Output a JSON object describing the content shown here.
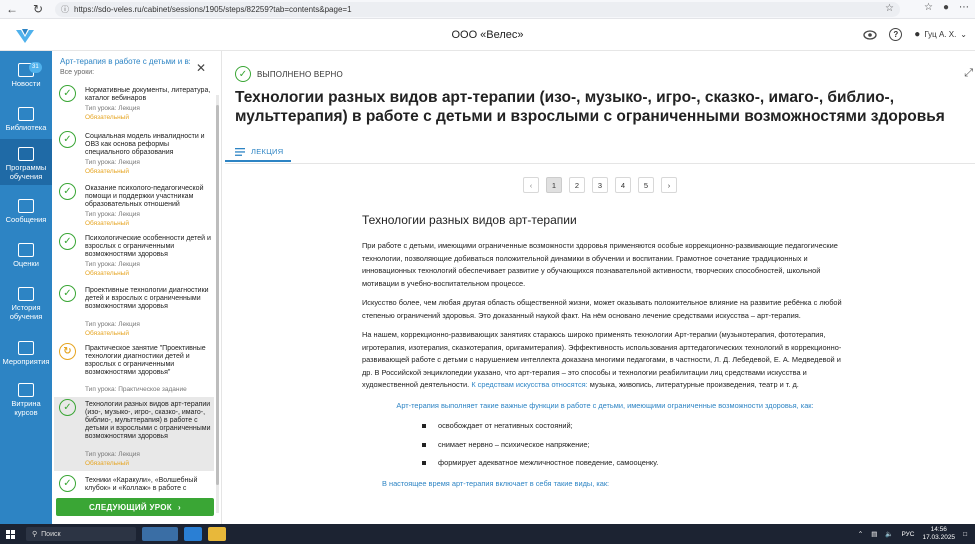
{
  "browser": {
    "url": "https://sdo-veles.ru/cabinet/sessions/1905/steps/82259?tab=contents&page=1"
  },
  "header": {
    "org": "ООО «Велес»",
    "user": "Гуц А. Х."
  },
  "leftnav": [
    {
      "label": "Новости",
      "badge": "31"
    },
    {
      "label": "Библиотека"
    },
    {
      "label": "Программы обучения"
    },
    {
      "label": "Сообщения"
    },
    {
      "label": "Оценки"
    },
    {
      "label": "История обучения"
    },
    {
      "label": "Мероприятия"
    },
    {
      "label": "Витрина курсов"
    }
  ],
  "lessons_panel": {
    "course_title": "Арт-терапия в работе с детьми и взр...",
    "subtitle": "Все уроки:",
    "items": [
      {
        "title": "Нормативные документы, литература, каталог вебинаров",
        "type": "Тип урока: Лекция",
        "required": "Обязательный",
        "status": "done"
      },
      {
        "title": "Социальная модель инвалидности и ОВЗ как основа реформы специального образования",
        "type": "Тип урока: Лекция",
        "required": "Обязательный",
        "status": "done"
      },
      {
        "title": "Оказание психолого-педагогической помощи и поддержки участникам образовательных отношений",
        "type": "Тип урока: Лекция",
        "required": "Обязательный",
        "status": "done"
      },
      {
        "title": "Психологические особенности детей и взрослых с ограниченными возможностями здоровья",
        "type": "Тип урока: Лекция",
        "required": "Обязательный",
        "status": "done"
      },
      {
        "title": "Проективные технологии диагностики детей и взрослых с ограниченными возможностями здоровья",
        "type": "Тип урока: Лекция",
        "required": "Обязательный",
        "status": "done"
      },
      {
        "title": "Практическое занятие \"Проективные технологии диагностики детей и взрослых с ограниченными возможностями здоровья\"",
        "type": "Тип урока: Практическое задание",
        "required": "",
        "status": "pending"
      },
      {
        "title": "Технологии разных видов арт-терапии (изо-, музыко-, игро-, сказко-, имаго-, библио-, мульттерапия) в работе с детьми и взрослыми с ограниченными возможностями здоровья",
        "type": "Тип урока: Лекция",
        "required": "Обязательный",
        "status": "done"
      },
      {
        "title": "Техники «Каракули», «Волшебный клубок» и «Коллаж» в работе с",
        "type": "",
        "required": "",
        "status": "done"
      }
    ],
    "next_button": "СЛЕДУЮЩИЙ УРОК"
  },
  "main": {
    "status": "ВЫПОЛНЕНО ВЕРНО",
    "title": "Технологии разных видов арт-терапии (изо-, музыко-, игро-, сказко-, имаго-, библио-, мульттерапия) в работе с детьми и взрослыми с ограниченными возможностями здоровья",
    "tab": "ЛЕКЦИЯ",
    "pages": [
      "1",
      "2",
      "3",
      "4",
      "5"
    ],
    "current_page": "1",
    "content": {
      "heading": "Технологии разных видов арт-терапии",
      "p1": "При работе с детьми, имеющими ограниченные возможности здоровья применяются особые коррекционно-развивающие педагогические технологии, позволяющие добиваться положительной динамики в обучении и воспитании. Грамотное сочетание традиционных и инновационных технологий обеспечивает развитие у обучающихся познавательной активности, творческих способностей, школьной мотивации в учебно-воспитательном процессе.",
      "p2": "Искусство более, чем любая другая область общественной жизни, может оказывать положительное влияние на развитие ребёнка с любой степенью ограничений здоровья. Это доказанный наукой факт. На нём основано лечение средствами искусства – арт-терапия.",
      "p3": "На нашем, коррекционно-развивающих занятиях стараюсь широко применять технологии Арт-терапии (музыкотерапия, фототерапия, игротерапия, изотерапия, сказкотерапия, оригамитерапия). Эффективность использования арттедагогических технологий в коррекционно-развивающей работе с детьми с нарушением интеллекта доказана многими педагогами, в частности, Л. Д. Лебедевой, Е. А. Медведевой и др. В Российской энциклопедии указано, что арт-терапия – это способы и технологии реабилитации лиц средствами искусства и художественной деятельности.",
      "p3_link": "К средствам искусства относятся:",
      "p3_tail": "музыка, живопись, литературные произведения, театр и т. д.",
      "functions_title": "Арт-терапия выполняет такие важные функции в работе с детьми, имеющими ограниченные возможности здоровья, как:",
      "functions": [
        "освобождает от негативных состояний;",
        "снимает нервно – психическое напряжение;",
        "формирует адекватное межличностное поведение, самооценку."
      ],
      "types_title": "В настоящее время арт-терапия включает в себя такие виды, как:"
    }
  },
  "taskbar": {
    "search": "Поиск",
    "lang": "РУС",
    "time": "14:56",
    "date": "17.03.2025"
  },
  "colors": {
    "accent": "#2d84c4",
    "success": "#3aa635",
    "warning": "#e6a522"
  }
}
